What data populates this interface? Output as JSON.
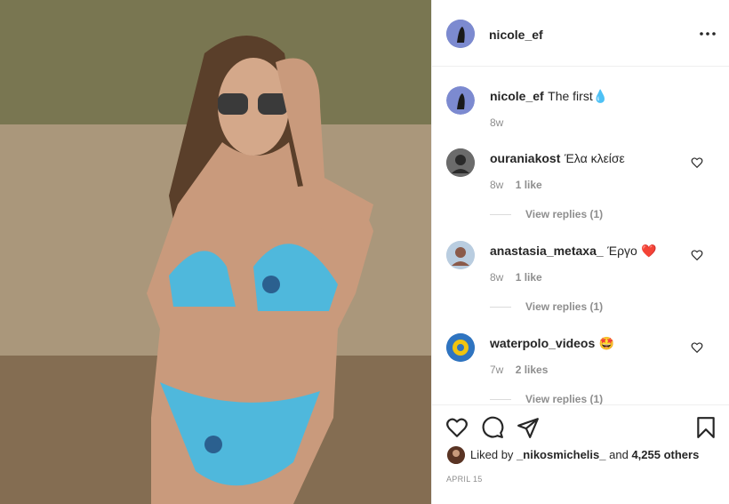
{
  "post": {
    "author": "nicole_ef",
    "caption": "The first",
    "caption_emoji": "💧",
    "caption_age": "8w"
  },
  "comments": [
    {
      "user": "ouraniakost",
      "text": "Έλα κλείσε",
      "emoji": "",
      "age": "8w",
      "likes": "1 like",
      "replies": "View replies (1)"
    },
    {
      "user": "anastasia_metaxa_",
      "text": "Έργο",
      "emoji": "❤️",
      "age": "8w",
      "likes": "1 like",
      "replies": "View replies (1)"
    },
    {
      "user": "waterpolo_videos",
      "text": "",
      "emoji": "🤩",
      "age": "7w",
      "likes": "2 likes",
      "replies": "View replies (1)"
    }
  ],
  "likes": {
    "prefix": "Liked by",
    "user": "_nikosmichelis_",
    "and": "and",
    "others": "4,255 others"
  },
  "date": "APRIL 15",
  "icons": [
    "more-icon",
    "heart-icon",
    "comment-icon",
    "share-icon",
    "bookmark-icon"
  ]
}
